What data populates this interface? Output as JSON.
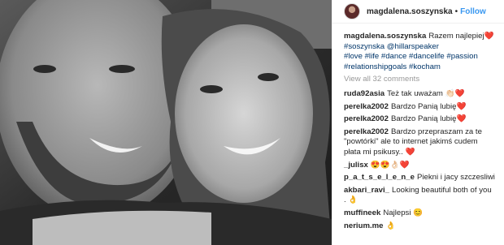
{
  "post": {
    "author": "magdalena.soszynska",
    "separator": "•",
    "follow_label": "Follow",
    "caption": {
      "username": "magdalena.soszynska",
      "text": "Razem najlepiej❤️",
      "tags_line1": "#soszynska @hillarspeaker",
      "tags_line2": "#love #life #dance #dancelife #passion",
      "tags_line3": "#relationshipgoals #kocham"
    },
    "view_all": "View all 32 comments",
    "comments": [
      {
        "user": "ruda92asia",
        "text": "Też tak uważam 👏🏻❤️"
      },
      {
        "user": "perelka2002",
        "text": "Bardzo Panią lubię❤️"
      },
      {
        "user": "perelka2002",
        "text": "Bardzo Panią lubię❤️"
      },
      {
        "user": "perelka2002",
        "text": "Bardzo przepraszam za te \"powtórki\" ale to internet jakimś cudem płata mi psikusy.. ❤️"
      },
      {
        "user": "_julisx",
        "text": "😍😍👌🏻❤️"
      },
      {
        "user": "p_a_t_s_e_l_e_n_e",
        "text": "Piekni i jacy szczesliwi"
      },
      {
        "user": "akbari_ravi_",
        "text": "Looking beautiful both of you . 👌"
      },
      {
        "user": "muffineek",
        "text": "Najlepsi 😊"
      },
      {
        "user": "nerium.me",
        "text": "👌"
      }
    ]
  }
}
